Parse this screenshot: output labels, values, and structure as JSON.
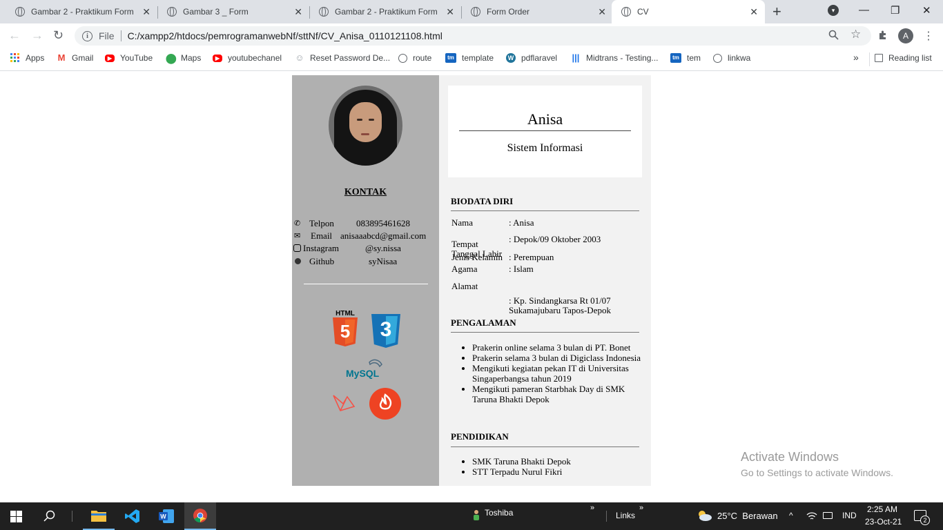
{
  "tabs": [
    {
      "title": "Gambar 2 - Praktikum Form",
      "close": "✕"
    },
    {
      "title": "Gambar 3 _ Form",
      "close": "✕"
    },
    {
      "title": "Gambar 2 - Praktikum Form",
      "close": "✕"
    },
    {
      "title": "Form Order",
      "close": "✕"
    },
    {
      "title": "CV",
      "close": "✕"
    }
  ],
  "window": {
    "new_tab": "+",
    "minimize": "—",
    "restore": "❐",
    "close": "✕",
    "tab_search": "▾"
  },
  "nav": {
    "back": "←",
    "forward": "→",
    "reload": "↻"
  },
  "address": {
    "info": "i",
    "scheme": "File",
    "url": "C:/xampp2/htdocs/pemrogramanwebNf/sttNf/CV_Anisa_0110121108.html"
  },
  "profile": {
    "initial": "A"
  },
  "bookmarks": [
    {
      "label": "Apps",
      "icon": "apps-icon"
    },
    {
      "label": "Gmail",
      "icon": "gmail-icon"
    },
    {
      "label": "YouTube",
      "icon": "youtube-icon"
    },
    {
      "label": "Maps",
      "icon": "maps-icon"
    },
    {
      "label": "youtubechanel",
      "icon": "youtube-icon"
    },
    {
      "label": "Reset Password De...",
      "icon": "user-icon"
    },
    {
      "label": "route",
      "icon": "globe-icon"
    },
    {
      "label": "template",
      "icon": "tm-icon"
    },
    {
      "label": "pdflaravel",
      "icon": "wordpress-icon"
    },
    {
      "label": "Midtrans - Testing...",
      "icon": "midtrans-icon"
    },
    {
      "label": "tem",
      "icon": "tm-icon"
    },
    {
      "label": "linkwa",
      "icon": "globe-icon"
    }
  ],
  "bookmark_overflow": "»",
  "reading_list": "Reading list",
  "cv": {
    "name": "Anisa",
    "major": "Sistem Informasi",
    "kontak_title": "KONTAK",
    "contacts": [
      {
        "label": "Telpon",
        "value": "083895461628",
        "icon": "phone-icon"
      },
      {
        "label": "Email",
        "value": "anisaaabcd@gmail.com",
        "icon": "email-icon"
      },
      {
        "label": "Instagram",
        "value": "@sy.nissa",
        "icon": "instagram-icon"
      },
      {
        "label": "Github",
        "value": "syNisaa",
        "icon": "github-icon"
      }
    ],
    "skills": {
      "html": "HTML",
      "html_num": "5",
      "css_num": "3",
      "mysql": "MySQL"
    },
    "biodata_title": "BIODATA DIRI",
    "biodata": [
      {
        "key": "Nama",
        "value": ": Anisa"
      },
      {
        "key": "Tempat\nTanggal Lahir",
        "value": ": Depok/09 Oktober 2003"
      },
      {
        "key": "Jenis Kelamin",
        "value": ": Perempuan"
      },
      {
        "key": "Agama",
        "value": ": Islam"
      },
      {
        "key": "Alamat",
        "value": ": Kp. Sindangkarsa Rt 01/07\nSukamajubaru Tapos-Depok"
      }
    ],
    "pengalaman_title": "PENGALAMAN",
    "pengalaman": [
      "Prakerin online selama 3 bulan di PT. Bonet",
      "Prakerin selama 3 bulan di Digiclass Indonesia",
      "Mengikuti kegiatan pekan IT di Universitas Singaperbangsa tahun 2019",
      "Mengikuti pameran Starbhak Day di SMK Taruna Bhakti Depok"
    ],
    "pendidikan_title": "PENDIDIKAN",
    "pendidikan": [
      "SMK Taruna Bhakti Depok",
      "STT Terpadu Nurul Fikri"
    ]
  },
  "watermark": {
    "title": "Activate Windows",
    "subtitle": "Go to Settings to activate Windows."
  },
  "taskbar": {
    "toolbar_label": "Toshiba",
    "links_label": "Links",
    "weather": "25°C  Berawan",
    "lang": "IND",
    "time": "2:25 AM",
    "date": "23-Oct-21",
    "notifications": "2"
  }
}
